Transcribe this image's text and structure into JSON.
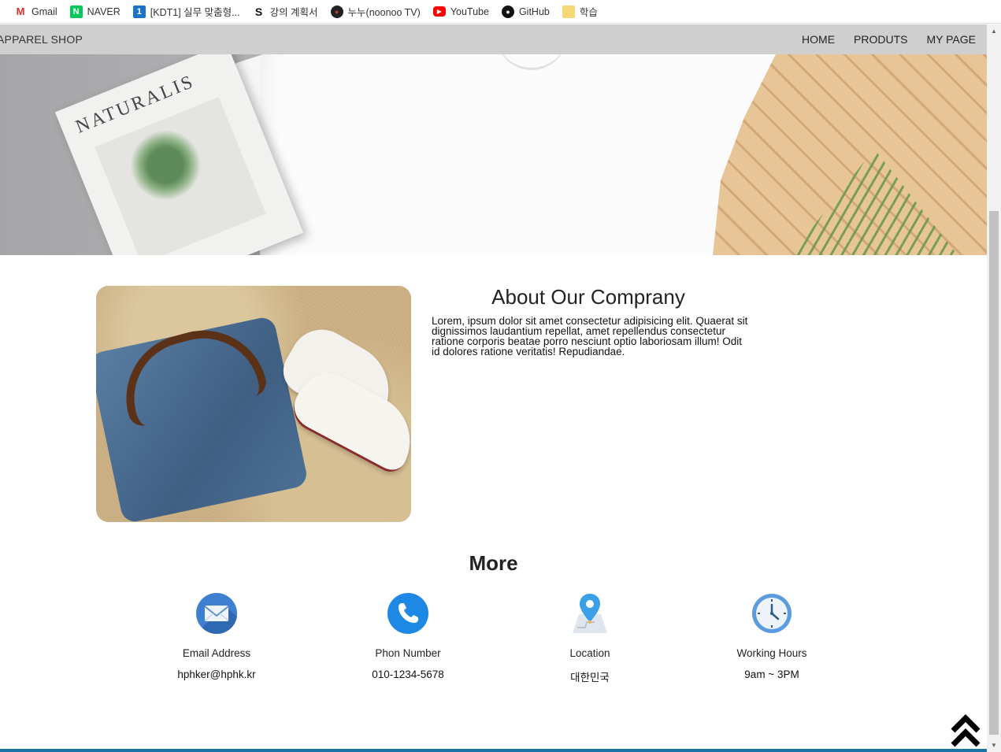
{
  "bookmarks": [
    {
      "label": "Gmail",
      "icon": "gmail-icon"
    },
    {
      "label": "NAVER",
      "icon": "naver-icon"
    },
    {
      "label": "[KDT1] 실무 맞춤형...",
      "icon": "kdt-icon"
    },
    {
      "label": "강의 계획서",
      "icon": "s-icon"
    },
    {
      "label": "누누(noonoo TV)",
      "icon": "noonoo-icon"
    },
    {
      "label": "YouTube",
      "icon": "youtube-icon"
    },
    {
      "label": "GitHub",
      "icon": "github-icon"
    },
    {
      "label": "학습",
      "icon": "folder-icon"
    }
  ],
  "navbar": {
    "brand": "APPAREL SHOP",
    "links": [
      "HOME",
      "PRODUTS",
      "MY PAGE"
    ],
    "background": "#cfcfcf"
  },
  "hero": {
    "magazine_title": "NATURALIS"
  },
  "about": {
    "title": "About Our Comprany",
    "text": "Lorem, ipsum dolor sit amet consectetur adipisicing elit. Quaerat sit dignissimos laudantium repellat, amet repellendus consectetur ratione corporis beatae porro nesciunt optio laboriosam illum! Odit id dolores ratione veritatis! Repudiandae."
  },
  "more": {
    "title": "More",
    "cards": [
      {
        "label": "Email Address",
        "value": "hphker@hphk.kr",
        "icon": "email-icon"
      },
      {
        "label": "Phon Number",
        "value": "010-1234-5678",
        "icon": "phone-icon"
      },
      {
        "label": "Location",
        "value": "대한민국",
        "icon": "location-icon"
      },
      {
        "label": "Working Hours",
        "value": "9am ~ 3PM",
        "icon": "clock-icon"
      }
    ]
  },
  "colors": {
    "accent_blue": "#1e88e5",
    "bottom_bar": "#1a73a8"
  }
}
